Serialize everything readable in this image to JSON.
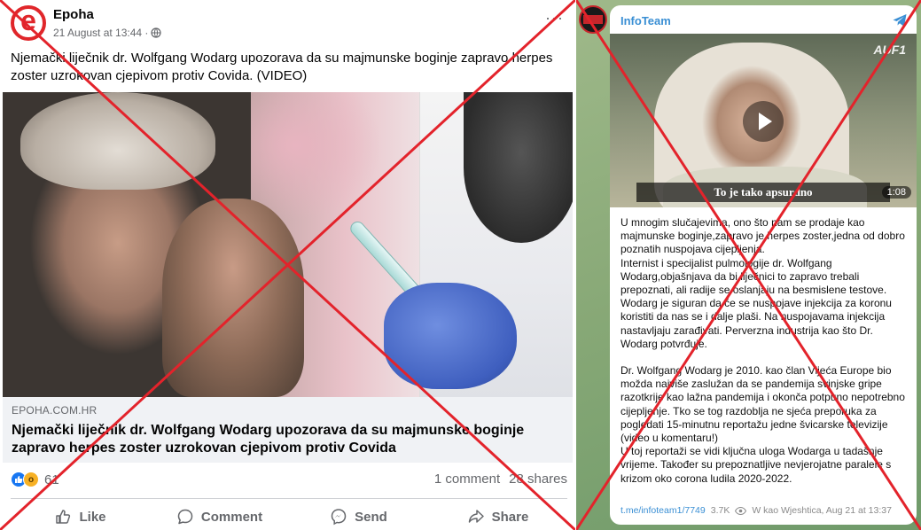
{
  "facebook_post": {
    "page_name": "Epoha",
    "timestamp": "21 August at 13:44 ·",
    "visibility_icon": "globe-icon",
    "more_icon": "more-dots-icon",
    "more_symbol": "···",
    "post_text": "Njemački liječnik dr. Wolfgang Wodarg upozorava da su majmunske boginje zapravo herpes zoster uzrokovan cjepivom protiv Covida. (VIDEO)",
    "info_symbol": "i",
    "link_preview": {
      "domain": "EPOHA.COM.HR",
      "title": "Njemački liječnik dr. Wolfgang Wodarg upozorava da su majmunske boginje zapravo herpes zoster uzrokovan cjepivom protiv Covida"
    },
    "reaction_count": "61",
    "comments": "1 comment",
    "shares": "28 shares",
    "actions": {
      "like": "Like",
      "comment": "Comment",
      "send": "Send",
      "share": "Share"
    }
  },
  "telegram_post": {
    "channel_name": "InfoTeam",
    "video": {
      "watermark": "AUF1",
      "subtitle": "To je tako apsurdno",
      "duration": "1:08"
    },
    "paragraphs": [
      "U mnogim slučajevima, ono što nam se prodaje kao majmunske boginje,zapravo je herpes zoster,jedna od dobro poznatih nuspojava cijepljenja.",
      "Internist i specijalist pulmologije dr. Wolfgang Wodarg,objašnjava da bi liječnici to zapravo trebali prepoznati, ali radije se oslanjaju na besmislene testove.",
      "Wodarg je siguran da će se nuspojave injekcija za koronu koristiti da nas se i dalje plaši. Na nuspojavama injekcija nastavljaju zarađivati. Perverzna industrija kao što Dr. Wodarg potvrđuje.",
      "Dr. Wolfgang Wodarg je 2010. kao član Vijeća Europe bio možda najviše zaslužan da se pandemija svinjske gripe razotkrije kao lažna pandemija i okonča potpuno nepotrebno cijepljenje. Tko se tog razdoblja ne sjeća preporuka za pogledati 15-minutnu reportažu jedne švicarske televizije (video u komentaru!)",
      "U toj reportaži se vidi ključna uloga Wodarga u tadašnje vrijeme. Također su prepoznatljive nevjerojatne paralele s krizom oko corona ludila 2020-2022."
    ],
    "link": "t.me/infoteam1/7749",
    "views": "3.7K",
    "views_icon": "eye-icon",
    "author_time": "W kao Wjeshtica, Aug 21 at 13:37"
  },
  "colors": {
    "cross_red": "#e3232b",
    "facebook_blue": "#1877f2",
    "telegram_blue": "#3a8fd4"
  }
}
